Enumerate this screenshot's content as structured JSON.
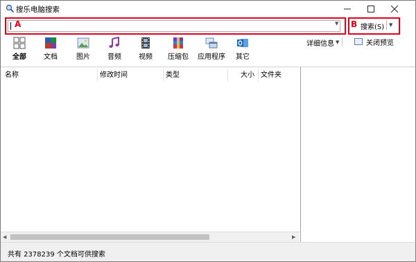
{
  "window": {
    "title": "搜乐电脑搜索"
  },
  "titlebar_icons": {
    "app": "search-icon",
    "minimize": "minimize-icon",
    "maximize": "maximize-icon",
    "close": "close-icon"
  },
  "search": {
    "value": "",
    "annotation_a": "A",
    "annotation_b": "B",
    "button_label": "搜索(S)",
    "annotation_color": "#e0001a"
  },
  "categories": [
    {
      "label": "全部",
      "icon": "grid-icon",
      "selected": true
    },
    {
      "label": "文档",
      "icon": "documents-icon",
      "selected": false
    },
    {
      "label": "图片",
      "icon": "image-icon",
      "selected": false
    },
    {
      "label": "音频",
      "icon": "music-note-icon",
      "selected": false
    },
    {
      "label": "视频",
      "icon": "film-icon",
      "selected": false
    },
    {
      "label": "压缩包",
      "icon": "archive-icon",
      "selected": false
    },
    {
      "label": "应用程序",
      "icon": "application-icon",
      "selected": false
    },
    {
      "label": "其它",
      "icon": "outlook-icon",
      "selected": false
    }
  ],
  "toolbar": {
    "details_label": "详细信息",
    "close_preview_label": "关闭预览"
  },
  "columns": [
    {
      "label": "名称"
    },
    {
      "label": "修改时间"
    },
    {
      "label": "类型"
    },
    {
      "label": "大小"
    },
    {
      "label": "文件夹"
    }
  ],
  "status": {
    "text": "共有 2378239 个文档可供搜索"
  }
}
